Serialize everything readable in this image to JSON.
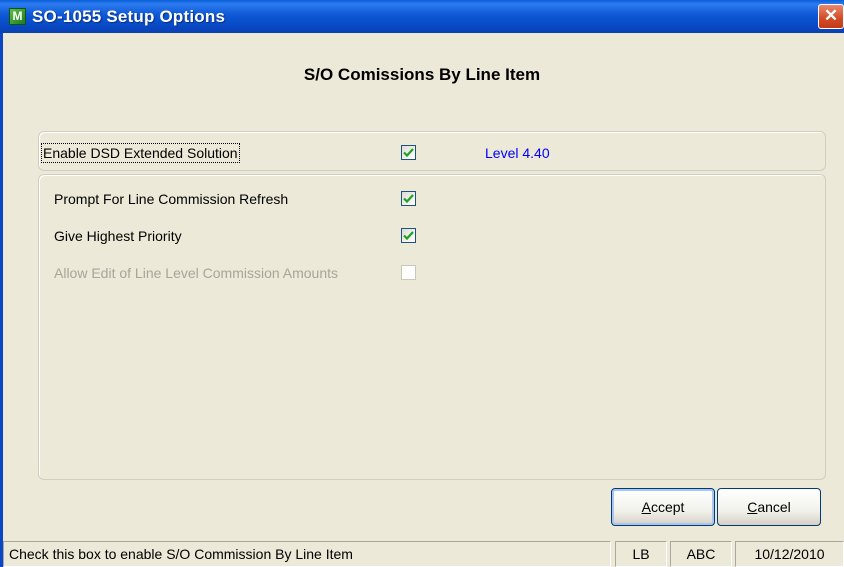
{
  "window": {
    "title": "SO-1055 Setup Options",
    "app_icon_letter": "M",
    "close_symbol": "✕"
  },
  "heading": "S/O Comissions By Line Item",
  "options": {
    "enable_dsd": {
      "label": "Enable DSD Extended Solution",
      "checked": true,
      "enabled": true
    },
    "level": "Level  4.40",
    "prompt_refresh": {
      "label": "Prompt For Line Commission Refresh",
      "checked": true,
      "enabled": true
    },
    "highest_priority": {
      "label": "Give Highest Priority",
      "checked": true,
      "enabled": true
    },
    "allow_edit": {
      "label": "Allow Edit of Line Level Commission Amounts",
      "checked": false,
      "enabled": false
    }
  },
  "buttons": {
    "accept": {
      "mnemonic": "A",
      "rest": "ccept"
    },
    "cancel": {
      "mnemonic": "C",
      "rest": "ancel"
    }
  },
  "statusbar": {
    "message": "Check this box to enable S/O Commission By Line Item",
    "user": "LB",
    "company": "ABC",
    "date": "10/12/2010"
  },
  "colors": {
    "titlebar": "#0A5FD8",
    "level_text": "#0000FF",
    "checkmark": "#21A121",
    "close_button": "#D24A25"
  },
  "icons": {
    "app": "app-icon",
    "close": "close-icon",
    "check": "checkmark-icon"
  }
}
